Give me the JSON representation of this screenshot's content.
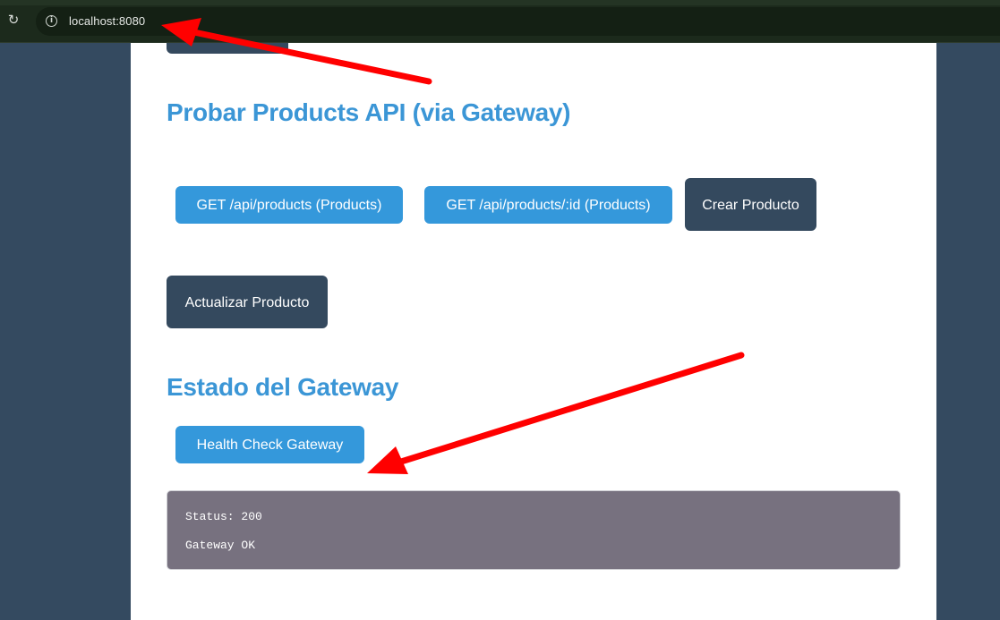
{
  "browser": {
    "url": "localhost:8080"
  },
  "sections": {
    "products_title": "Probar Products API (via Gateway)",
    "gateway_title": "Estado del Gateway"
  },
  "buttons": {
    "get_all": "GET /api/products (Products)",
    "get_by_id": "GET /api/products/:id (Products)",
    "crear": "Crear Producto",
    "actualizar": "Actualizar Producto",
    "health_check": "Health Check Gateway"
  },
  "result": {
    "status_line": "Status: 200",
    "message_line": "Gateway OK"
  },
  "colors": {
    "accent_blue": "#3498db",
    "heading_blue": "#3b96d6",
    "dark_button": "#34495e",
    "background": "#344a60",
    "result_box": "#77717f",
    "annotation_arrow": "#ff0000"
  }
}
